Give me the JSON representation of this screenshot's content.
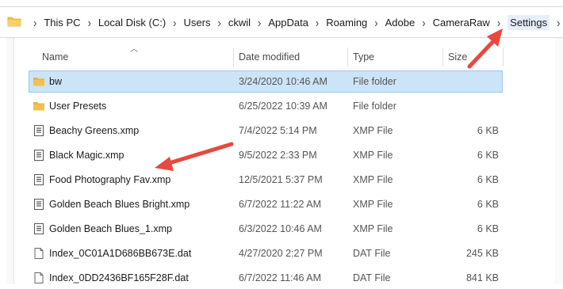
{
  "breadcrumb": [
    "This PC",
    "Local Disk (C:)",
    "Users",
    "ckwil",
    "AppData",
    "Roaming",
    "Adobe",
    "CameraRaw",
    "Settings"
  ],
  "columns": {
    "name": "Name",
    "date": "Date modified",
    "type": "Type",
    "size": "Size"
  },
  "files": [
    {
      "name": "bw",
      "date": "3/24/2020 10:46 AM",
      "type": "File folder",
      "size": "",
      "icon": "folder-icon",
      "selected": true
    },
    {
      "name": "User Presets",
      "date": "6/25/2022 10:39 AM",
      "type": "File folder",
      "size": "",
      "icon": "folder-icon",
      "selected": false
    },
    {
      "name": "Beachy Greens.xmp",
      "date": "7/4/2022 5:14 PM",
      "type": "XMP File",
      "size": "6 KB",
      "icon": "xmp-file-icon",
      "selected": false
    },
    {
      "name": "Black Magic.xmp",
      "date": "9/5/2022 2:33 PM",
      "type": "XMP File",
      "size": "6 KB",
      "icon": "xmp-file-icon",
      "selected": false
    },
    {
      "name": "Food Photography Fav.xmp",
      "date": "12/5/2021 5:37 PM",
      "type": "XMP File",
      "size": "6 KB",
      "icon": "xmp-file-icon",
      "selected": false
    },
    {
      "name": "Golden Beach Blues Bright.xmp",
      "date": "6/7/2022 11:22 AM",
      "type": "XMP File",
      "size": "6 KB",
      "icon": "xmp-file-icon",
      "selected": false
    },
    {
      "name": "Golden Beach Blues_1.xmp",
      "date": "6/3/2022 10:46 AM",
      "type": "XMP File",
      "size": "6 KB",
      "icon": "xmp-file-icon",
      "selected": false
    },
    {
      "name": "Index_0C01A1D686BB673E.dat",
      "date": "4/27/2020 2:27 PM",
      "type": "DAT File",
      "size": "245 KB",
      "icon": "dat-file-icon",
      "selected": false
    },
    {
      "name": "Index_0DD2436BF165F28F.dat",
      "date": "6/7/2022 11:46 AM",
      "type": "DAT File",
      "size": "841 KB",
      "icon": "dat-file-icon",
      "selected": false
    }
  ],
  "colors": {
    "selection": "#cce4f7",
    "selection_border": "#99c9ef",
    "annotation_arrow": "#e8483d",
    "folder": "#f4c14e"
  }
}
